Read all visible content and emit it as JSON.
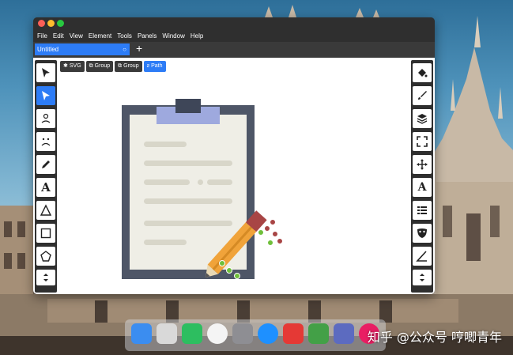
{
  "window": {
    "controls": [
      "close",
      "minimize",
      "zoom"
    ]
  },
  "menu": [
    "File",
    "Edit",
    "View",
    "Element",
    "Tools",
    "Panels",
    "Window",
    "Help"
  ],
  "tab": {
    "label": "Untitled",
    "close_glyph": "○",
    "add_glyph": "+"
  },
  "breadcrumbs": [
    {
      "icon": "svg-icon",
      "glyph": "✱",
      "label": "SVG"
    },
    {
      "icon": "group-icon",
      "glyph": "⧉",
      "label": "Group"
    },
    {
      "icon": "group-icon",
      "glyph": "⧉",
      "label": "Group"
    },
    {
      "icon": "path-icon",
      "glyph": "ƨ",
      "label": "Path",
      "active": true
    }
  ],
  "left_tools": [
    {
      "name": "select-tool",
      "icon": "arrow-icon"
    },
    {
      "name": "edit-tool",
      "icon": "node-arrow-icon",
      "active": true
    },
    {
      "name": "smile-tool",
      "icon": "face-icon"
    },
    {
      "name": "sad-tool",
      "icon": "sad-face-icon"
    },
    {
      "name": "pencil-tool",
      "icon": "pencil-icon"
    },
    {
      "name": "text-tool",
      "icon": "text-icon",
      "glyph": "A"
    },
    {
      "name": "triangle-tool",
      "icon": "triangle-icon"
    },
    {
      "name": "rectangle-tool",
      "icon": "square-icon"
    },
    {
      "name": "pentagon-tool",
      "icon": "pentagon-icon"
    },
    {
      "name": "more-tools",
      "icon": "arrows-icon"
    }
  ],
  "right_tools": [
    {
      "name": "fill-tool",
      "icon": "paint-bucket-icon"
    },
    {
      "name": "brush-tool",
      "icon": "brush-icon"
    },
    {
      "name": "layers-tool",
      "icon": "layers-icon"
    },
    {
      "name": "fullscreen-tool",
      "icon": "expand-icon"
    },
    {
      "name": "move-tool",
      "icon": "move-icon"
    },
    {
      "name": "font-tool",
      "icon": "font-size-icon",
      "glyph": "A"
    },
    {
      "name": "list-tool",
      "icon": "list-icon"
    },
    {
      "name": "mask-tool",
      "icon": "mask-icon"
    },
    {
      "name": "measure-tool",
      "icon": "angle-icon"
    },
    {
      "name": "more-panels",
      "icon": "arrows-icon"
    }
  ],
  "colors": {
    "accent": "#2d7cf6",
    "clipboard_board": "#4e5667",
    "clipboard_paper": "#efeee6",
    "clipboard_clip": "#9ea9de",
    "clipboard_clip_dark": "#3e4658",
    "text_lines": "#d8d6c9",
    "pencil_body": "#f0a33a",
    "pencil_stripe": "#d58a24",
    "pencil_eraser": "#a84545",
    "pencil_tip": "#e9d9b5",
    "handle_green": "#6fbf3b"
  },
  "dock": [
    "finder-icon",
    "launchpad-icon",
    "evernote-icon",
    "chrome-icon",
    "system-preferences-icon",
    "app-store-icon",
    "xmind-icon",
    "wps-icon",
    "vmware-icon",
    "music-icon",
    "wechat-icon",
    "trash-icon"
  ],
  "watermark": "知乎 @公众号 哼唧青年"
}
